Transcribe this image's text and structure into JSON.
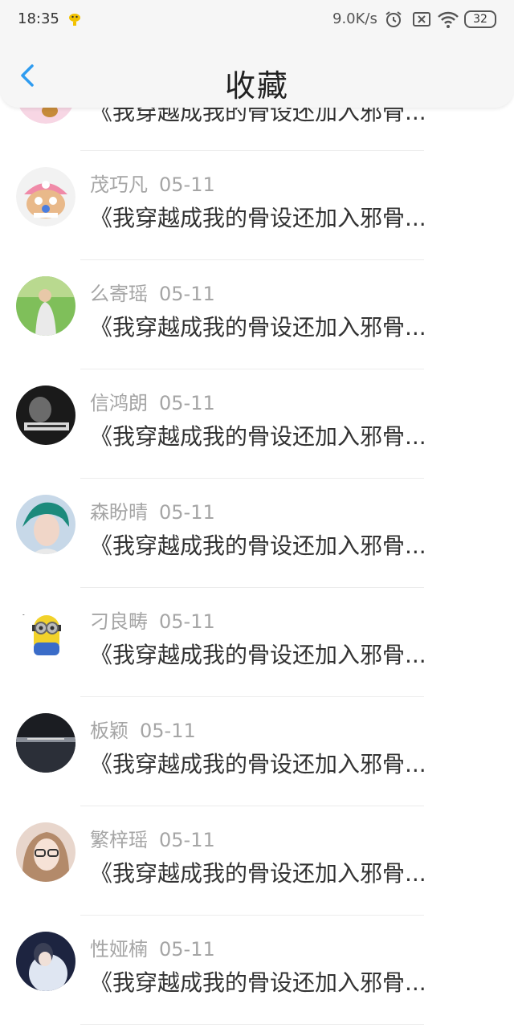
{
  "status_bar": {
    "time": "18:35",
    "net_speed": "9.0K/s",
    "battery": "32"
  },
  "header": {
    "title": "收藏"
  },
  "list": [
    {
      "name": "",
      "date": "",
      "content": "《我穿越成我的骨设还加入邪骨..."
    },
    {
      "name": "茂巧凡",
      "date": "05-11",
      "content": "《我穿越成我的骨设还加入邪骨..."
    },
    {
      "name": "么寄瑶",
      "date": "05-11",
      "content": "《我穿越成我的骨设还加入邪骨..."
    },
    {
      "name": "信鸿朗",
      "date": "05-11",
      "content": "《我穿越成我的骨设还加入邪骨..."
    },
    {
      "name": "森盼晴",
      "date": "05-11",
      "content": "《我穿越成我的骨设还加入邪骨..."
    },
    {
      "name": "刁良畴",
      "date": "05-11",
      "content": "《我穿越成我的骨设还加入邪骨..."
    },
    {
      "name": "板颖",
      "date": "05-11",
      "content": "《我穿越成我的骨设还加入邪骨..."
    },
    {
      "name": "繁梓瑶",
      "date": "05-11",
      "content": "《我穿越成我的骨设还加入邪骨..."
    },
    {
      "name": "性娅楠",
      "date": "05-11",
      "content": "《我穿越成我的骨设还加入邪骨..."
    }
  ],
  "colors": {
    "accent": "#2f9cf0",
    "header_bg": "#f6f6f6",
    "meta_text": "#a5a5a5",
    "content_text": "#333333"
  }
}
